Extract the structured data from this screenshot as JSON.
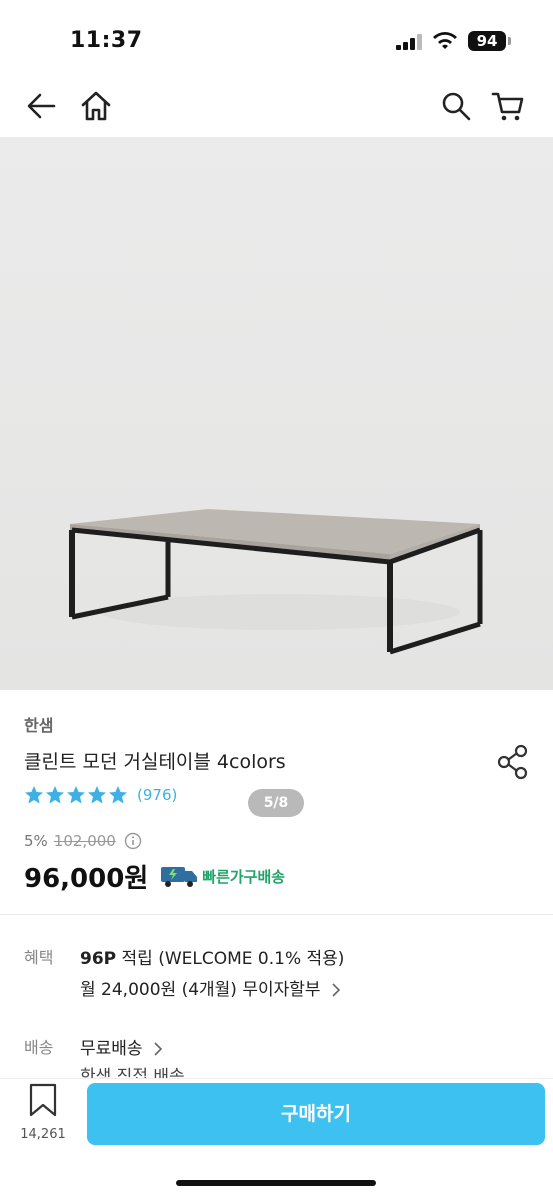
{
  "status_bar": {
    "time": "11:37",
    "battery": "94"
  },
  "nav": {
    "back_icon": "arrow-left-icon",
    "home_icon": "home-icon",
    "search_icon": "search-icon",
    "cart_icon": "cart-icon"
  },
  "gallery": {
    "counter": "5/8"
  },
  "product": {
    "brand": "한샘",
    "title": "클린트 모던 거실테이블 4colors",
    "rating_stars": 5,
    "review_count": "(976)",
    "discount_rate": "5%",
    "original_price": "102,000",
    "sale_price": "96,000원",
    "fast_delivery_label": "빠른가구배송"
  },
  "benefit": {
    "label": "혜택",
    "points": "96P",
    "points_text": " 적립 (WELCOME 0.1% 적용)",
    "installment": "월 24,000원 (4개월) 무이자할부"
  },
  "delivery": {
    "label": "배송",
    "type": "무료배송",
    "detail": "한샘 직접 배송"
  },
  "bottom": {
    "bookmark_count": "14,261",
    "buy_label": "구매하기"
  },
  "colors": {
    "accent": "#3dc1f0",
    "star": "#3db1e6",
    "delivery_green": "#1fa46b"
  }
}
